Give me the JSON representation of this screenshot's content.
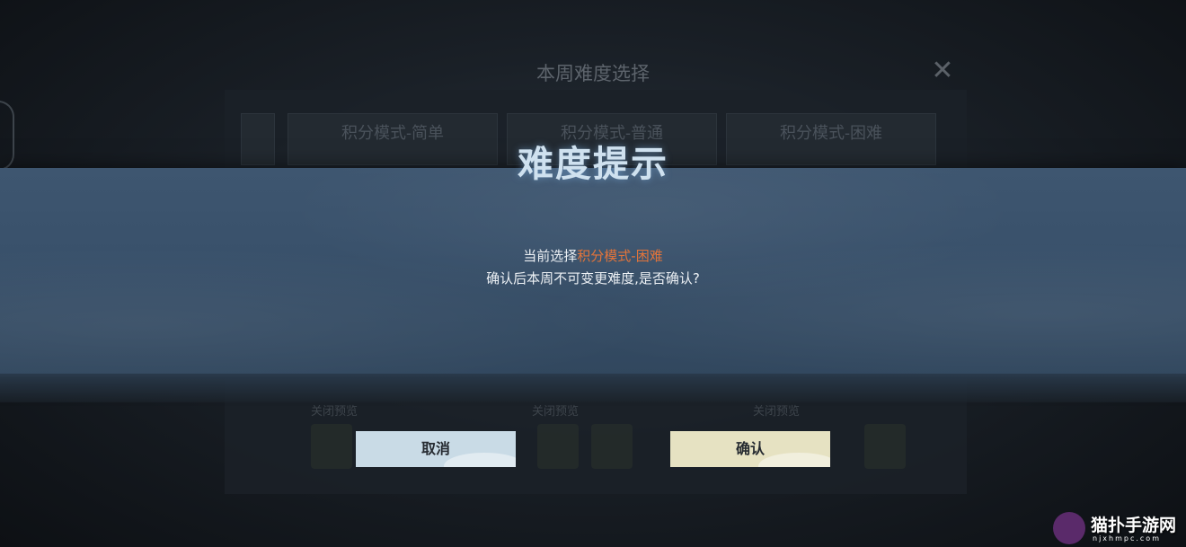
{
  "background": {
    "panel_title": "本周难度选择",
    "tabs": [
      "积分模式-简单",
      "积分模式-普通",
      "积分模式-困难"
    ],
    "preview_labels": [
      "关闭预览",
      "关闭预览",
      "关闭预览"
    ]
  },
  "dialog": {
    "title": "难度提示",
    "line1_prefix": "当前选择",
    "line1_highlight": "积分模式-困难",
    "line2": "确认后本周不可变更难度,是否确认?",
    "cancel_label": "取消",
    "confirm_label": "确认"
  },
  "watermark": {
    "name": "猫扑手游网",
    "url": "njxhmpc.com"
  },
  "colors": {
    "highlight": "#e3743a",
    "cancel_button": "#c9dbe6",
    "confirm_button": "#e6e2c2",
    "banner": "#3e5670"
  }
}
